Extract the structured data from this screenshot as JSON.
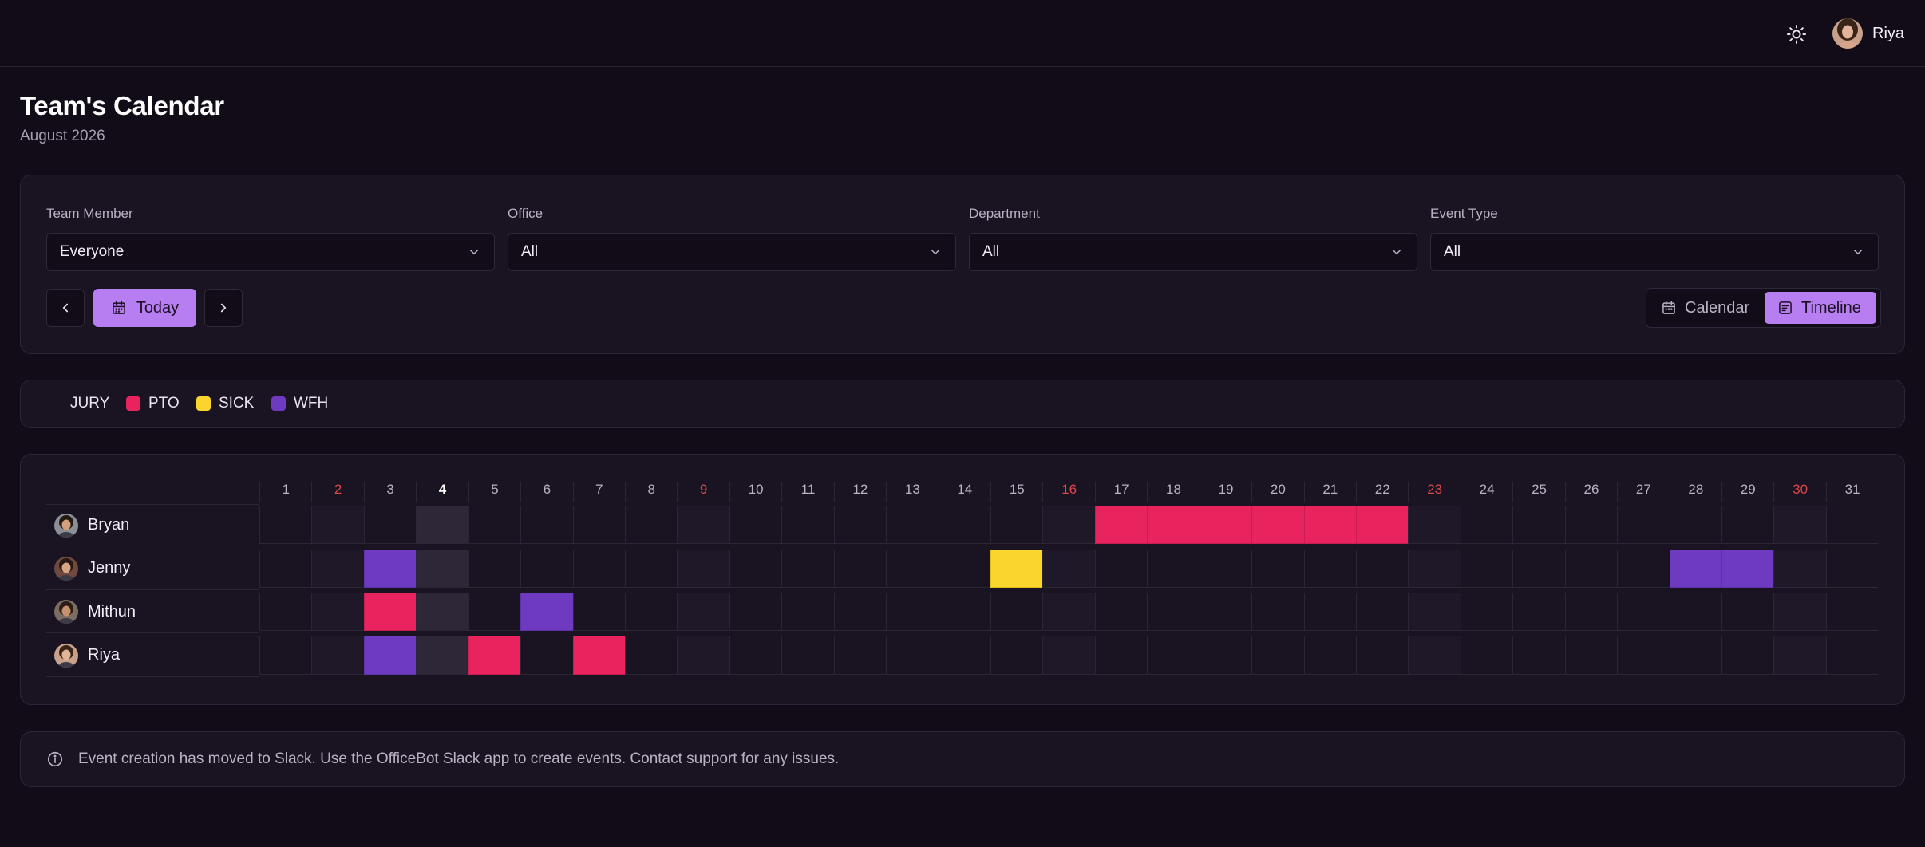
{
  "header": {
    "theme_icon": "sun-icon",
    "user_name": "Riya"
  },
  "page": {
    "title": "Team's Calendar",
    "subtitle": "August 2026"
  },
  "filters": [
    {
      "label": "Team Member",
      "value": "Everyone"
    },
    {
      "label": "Office",
      "value": "All"
    },
    {
      "label": "Department",
      "value": "All"
    },
    {
      "label": "Event Type",
      "value": "All"
    }
  ],
  "toolbar": {
    "today_label": "Today",
    "view_calendar_label": "Calendar",
    "view_timeline_label": "Timeline",
    "active_view": "Timeline"
  },
  "legend": [
    {
      "label": "JURY",
      "color": ""
    },
    {
      "label": "PTO",
      "color": "#e9235e"
    },
    {
      "label": "SICK",
      "color": "#fad52e"
    },
    {
      "label": "WFH",
      "color": "#6e3bc0"
    }
  ],
  "timeline": {
    "days": [
      "1",
      "2",
      "3",
      "4",
      "5",
      "6",
      "7",
      "8",
      "9",
      "10",
      "11",
      "12",
      "13",
      "14",
      "15",
      "16",
      "17",
      "18",
      "19",
      "20",
      "21",
      "22",
      "23",
      "24",
      "25",
      "26",
      "27",
      "28",
      "29",
      "30",
      "31"
    ],
    "weekend_days": [
      2,
      9,
      16,
      23,
      30
    ],
    "today": 4,
    "members": [
      {
        "name": "Bryan",
        "events": [
          {
            "day": 17,
            "type": "PTO"
          },
          {
            "day": 18,
            "type": "PTO"
          },
          {
            "day": 19,
            "type": "PTO"
          },
          {
            "day": 20,
            "type": "PTO"
          },
          {
            "day": 21,
            "type": "PTO"
          },
          {
            "day": 22,
            "type": "PTO"
          }
        ]
      },
      {
        "name": "Jenny",
        "events": [
          {
            "day": 3,
            "type": "WFH"
          },
          {
            "day": 15,
            "type": "SICK"
          },
          {
            "day": 28,
            "type": "WFH"
          },
          {
            "day": 29,
            "type": "WFH"
          }
        ]
      },
      {
        "name": "Mithun",
        "events": [
          {
            "day": 3,
            "type": "PTO"
          },
          {
            "day": 6,
            "type": "WFH"
          }
        ]
      },
      {
        "name": "Riya",
        "events": [
          {
            "day": 3,
            "type": "WFH"
          },
          {
            "day": 5,
            "type": "PTO"
          },
          {
            "day": 7,
            "type": "PTO"
          }
        ]
      }
    ]
  },
  "notice": {
    "icon": "info-icon",
    "text": "Event creation has moved to Slack. Use the OfficeBot Slack app to create events. Contact support for any issues."
  }
}
